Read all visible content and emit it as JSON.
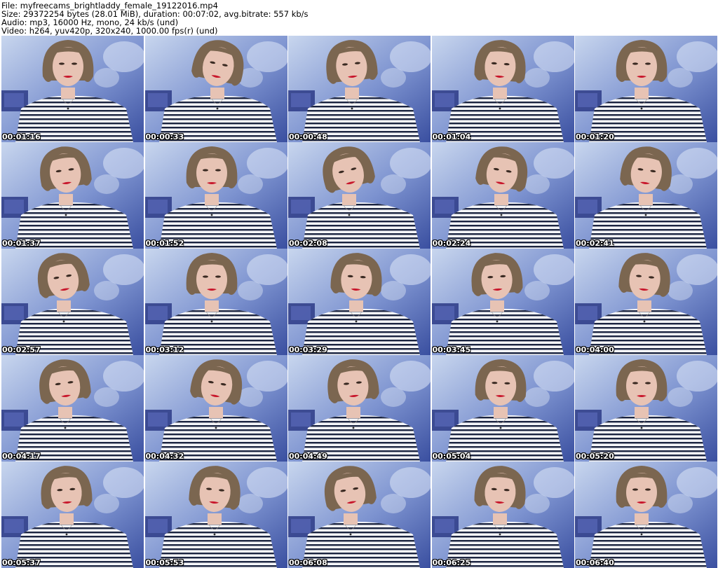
{
  "header": {
    "file": "File: myfreecams_brightladdy_female_19122016.mp4",
    "size": "Size: 29372254 bytes (28.01 MiB), duration: 00:07:02, avg.bitrate: 557 kb/s",
    "audio": "Audio: mp3, 16000 Hz, mono, 24 kb/s (und)",
    "video": "Video: h264, yuv420p, 320x240, 1000.00 fps(r) (und)"
  },
  "colors": {
    "background_light": "#c8d6ee",
    "background_dark": "#3a4fa0",
    "stripe_dark": "#1b2440",
    "shirt_white": "#f4f5f8",
    "hair": "#7b6650",
    "skin": "#e7c3b4",
    "lips": "#c8162b"
  },
  "thumbnails": [
    {
      "time": "00:01:16"
    },
    {
      "time": "00:00:33"
    },
    {
      "time": "00:00:48"
    },
    {
      "time": "00:01:04"
    },
    {
      "time": "00:01:20"
    },
    {
      "time": "00:01:37"
    },
    {
      "time": "00:01:52"
    },
    {
      "time": "00:02:08"
    },
    {
      "time": "00:02:24"
    },
    {
      "time": "00:02:41"
    },
    {
      "time": "00:02:57"
    },
    {
      "time": "00:03:12"
    },
    {
      "time": "00:03:29"
    },
    {
      "time": "00:03:45"
    },
    {
      "time": "00:04:00"
    },
    {
      "time": "00:04:17"
    },
    {
      "time": "00:04:32"
    },
    {
      "time": "00:04:49"
    },
    {
      "time": "00:05:04"
    },
    {
      "time": "00:05:20"
    },
    {
      "time": "00:05:37"
    },
    {
      "time": "00:05:53"
    },
    {
      "time": "00:06:08"
    },
    {
      "time": "00:06:25"
    },
    {
      "time": "00:06:40"
    }
  ]
}
